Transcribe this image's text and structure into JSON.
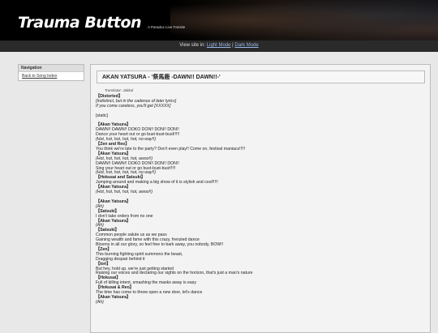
{
  "header": {
    "title": "Trauma Button",
    "subtitle": "A Paradox Live Fansite"
  },
  "viewbar": {
    "prefix": "View site in:",
    "light": "Light Mode",
    "sep": "|",
    "dark": "Dark Mode"
  },
  "nav": {
    "heading": "Navigation",
    "items": [
      {
        "label": "Back to Song Index"
      }
    ]
  },
  "song": {
    "title": "AKAN YATSURA - '祭馬鹿 -DAWN!! DAWN!!-'",
    "translator": "Translator: Jakkal"
  },
  "lyrics": [
    {
      "t": "【Distorted】",
      "s": "spk"
    },
    {
      "t": "[Indistinct, but in the cadence of later lyrics]",
      "s": "it"
    },
    {
      "t": "If you come careless, you'll get [XXXXX]",
      "s": "it"
    },
    {
      "t": "",
      "s": "gap"
    },
    {
      "t": "[static]",
      "s": ""
    },
    {
      "t": "",
      "s": "gap"
    },
    {
      "t": "【Akan Yatsura】",
      "s": "spk"
    },
    {
      "t": "DAWN!! DAWN!! DOKO DON!! DON!! DON!!",
      "s": ""
    },
    {
      "t": "Dance your heart out or go bust-bust-bust!!!!!",
      "s": ""
    },
    {
      "t": "(Hot, hot, hot, hot, hot, no way!!)",
      "s": "it"
    },
    {
      "t": "【Zen and Reo】",
      "s": "spk"
    },
    {
      "t": "You think we're late to the party? Don't even play!! Come on, festival maniacs!!!!!",
      "s": ""
    },
    {
      "t": "【Akan Yatsura】",
      "s": "spk"
    },
    {
      "t": "(Hot, hot, hot, hot, hot, awoo!!)",
      "s": "it"
    },
    {
      "t": "DAWN!! DAWN!! DOKO DON!! DON!! DON!!",
      "s": ""
    },
    {
      "t": "Sing your heart out or go bust-bust-bust!!!!!",
      "s": ""
    },
    {
      "t": "(Hot, hot, hot, hot, hot, no way!!)",
      "s": "it"
    },
    {
      "t": "【Hokusai and Satsuki】",
      "s": "spk"
    },
    {
      "t": "Jumping around and making a big show of it is stylish and cool!!!!!",
      "s": ""
    },
    {
      "t": "【Akan Yatsura】",
      "s": "spk"
    },
    {
      "t": "(Hot, hot, hot, hot, hot, awoo!!)",
      "s": "it"
    },
    {
      "t": "",
      "s": "gap"
    },
    {
      "t": "【Akan Yatsura】",
      "s": "spk"
    },
    {
      "t": "(Ah)",
      "s": "it"
    },
    {
      "t": "【Satsuki】",
      "s": "spk"
    },
    {
      "t": "I don't take orders from no one",
      "s": ""
    },
    {
      "t": "【Akan Yatsura】",
      "s": "spk"
    },
    {
      "t": "(Ah)",
      "s": "it"
    },
    {
      "t": "【Satsuki】",
      "s": "spk"
    },
    {
      "t": "Common people salute us as we pass",
      "s": ""
    },
    {
      "t": "Gaining wealth and fame with this crazy, frenzied dance",
      "s": ""
    },
    {
      "t": "Blooms in all our glory, so feel free to bark away, you nobody, BOW!!",
      "s": ""
    },
    {
      "t": "【Zen】",
      "s": "spk"
    },
    {
      "t": "This burning fighting spirit summons the beast,",
      "s": ""
    },
    {
      "t": "Dragging despair behind it",
      "s": ""
    },
    {
      "t": "【Iori】",
      "s": "spk"
    },
    {
      "t": "But hey, hold up, we're just getting started",
      "s": ""
    },
    {
      "t": "Raising our voices and declaring our sights on the horizon, that's just a man's nature",
      "s": ""
    },
    {
      "t": "【Hokusai】",
      "s": "spk"
    },
    {
      "t": "Full of killing intent, smashing the masks away is easy",
      "s": ""
    },
    {
      "t": "【Hokusai & Reo】",
      "s": "spk"
    },
    {
      "t": "The time has come to throw open a new door, let's dance",
      "s": ""
    },
    {
      "t": "【Akan Yatsura】",
      "s": "spk"
    },
    {
      "t": "(Ah)",
      "s": "it"
    }
  ]
}
